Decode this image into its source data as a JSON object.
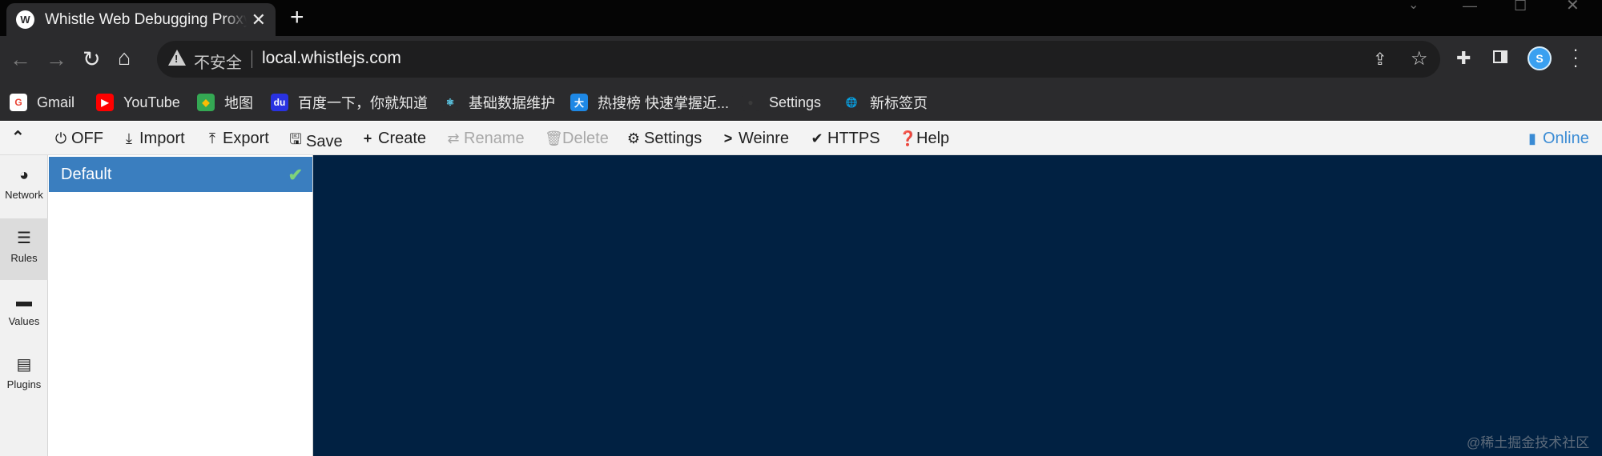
{
  "browser": {
    "tab_title": "Whistle Web Debugging Proxy",
    "tab_favicon": "W",
    "tab_close": "✕",
    "new_tab": "+",
    "omnibox": {
      "security_label": "不安全",
      "url": "local.whistlejs.com"
    },
    "bookmarks": [
      {
        "label": "Gmail",
        "icon": "gmail-icon",
        "glyph": "G",
        "color": "#ffffff",
        "fg": "#ea4335"
      },
      {
        "label": "YouTube",
        "icon": "youtube-icon",
        "glyph": "▶",
        "color": "#ff0000",
        "fg": "#ffffff"
      },
      {
        "label": "地图",
        "icon": "maps-icon",
        "glyph": "◆",
        "color": "#34a853",
        "fg": "#fbbc04"
      },
      {
        "label": "百度一下，你就知道",
        "icon": "baidu-icon",
        "glyph": "du",
        "color": "#2932e1",
        "fg": "#ffffff"
      },
      {
        "label": "基础数据维护",
        "icon": "react-icon",
        "glyph": "⚛",
        "color": "#2b2b2d",
        "fg": "#61dafb"
      },
      {
        "label": "热搜榜 快速掌握近...",
        "icon": "da-icon",
        "glyph": "大",
        "color": "#1e88e5",
        "fg": "#ffffff"
      },
      {
        "label": "Settings",
        "icon": "github-icon",
        "glyph": "●",
        "color": "#2b2b2d",
        "fg": "#3a3a3a"
      },
      {
        "label": "新标签页",
        "icon": "globe-icon",
        "glyph": "🌐",
        "color": "#2b2b2d",
        "fg": "#e8e8e8"
      }
    ]
  },
  "whistle": {
    "toolbar": {
      "off": "OFF",
      "import": "Import",
      "export": "Export",
      "save": "Save",
      "create": "Create",
      "rename": "Rename",
      "delete": "Delete",
      "settings": "Settings",
      "weinre": "Weinre",
      "https": "HTTPS",
      "help": "Help",
      "online": "Online"
    },
    "nav": [
      {
        "label": "Network",
        "icon": "globe-icon",
        "active": false
      },
      {
        "label": "Rules",
        "icon": "list-icon",
        "active": true
      },
      {
        "label": "Values",
        "icon": "folder-icon",
        "active": false
      },
      {
        "label": "Plugins",
        "icon": "plugin-icon",
        "active": false
      }
    ],
    "rules": [
      {
        "name": "Default",
        "enabled": true
      }
    ],
    "editor_background": "#012142",
    "accent": "#3a7ebf"
  },
  "watermark": "@稀土掘金技术社区"
}
